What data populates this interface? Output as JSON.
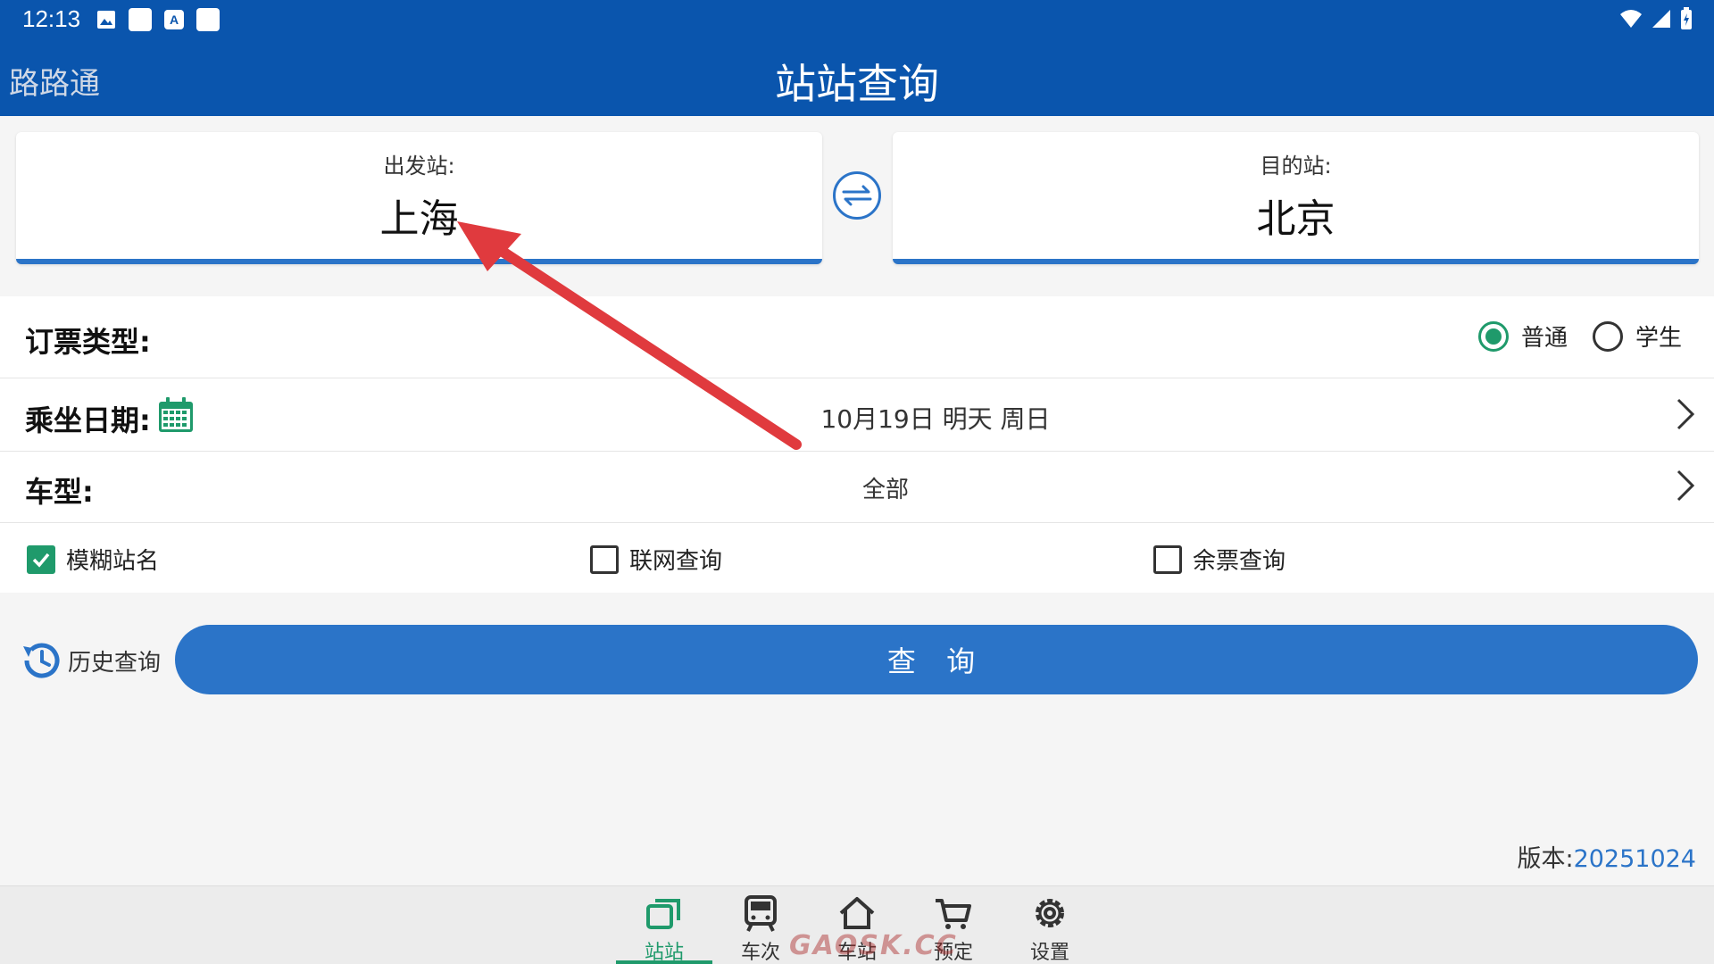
{
  "status": {
    "time": "12:13",
    "icon_a": "A"
  },
  "header": {
    "app_name": "路路通",
    "title": "站站查询"
  },
  "stations": {
    "from_label": "出发站:",
    "from_value": "上海",
    "to_label": "目的站:",
    "to_value": "北京"
  },
  "ticket_type": {
    "label": "订票类型:",
    "options": [
      {
        "label": "普通",
        "selected": true
      },
      {
        "label": "学生",
        "selected": false
      }
    ]
  },
  "date": {
    "label": "乘坐日期:",
    "value": "10月19日 明天 周日"
  },
  "train_type": {
    "label": "车型:",
    "value": "全部"
  },
  "options": [
    {
      "label": "模糊站名",
      "checked": true
    },
    {
      "label": "联网查询",
      "checked": false
    },
    {
      "label": "余票查询",
      "checked": false
    }
  ],
  "history_label": "历史查询",
  "query_label": "查 询",
  "version": {
    "label": "版本:",
    "number": "20251024"
  },
  "nav": [
    {
      "label": "站站",
      "active": true
    },
    {
      "label": "车次",
      "active": false
    },
    {
      "label": "车站",
      "active": false
    },
    {
      "label": "预定",
      "active": false
    },
    {
      "label": "设置",
      "active": false
    }
  ],
  "watermark": "GAOSK.CC",
  "colors": {
    "primary": "#0a55ad",
    "accent": "#2b74c8",
    "green": "#1f9a6b",
    "arrow": "#e03a3e"
  }
}
